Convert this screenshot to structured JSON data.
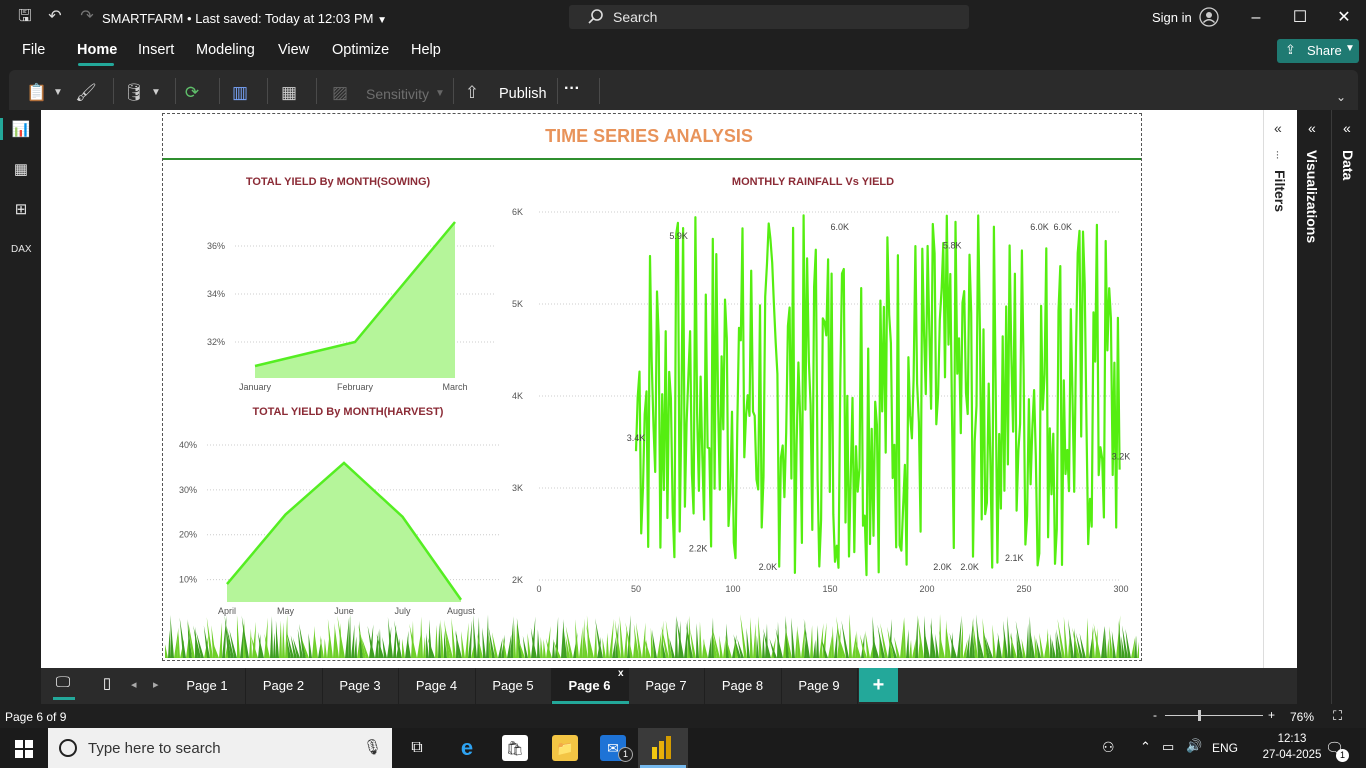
{
  "app": {
    "doc_title": "SMARTFARM",
    "saved_status": "Last saved: Today at 12:03 PM",
    "search_placeholder": "Search",
    "sign_in": "Sign in"
  },
  "menu": {
    "file": "File",
    "home": "Home",
    "insert": "Insert",
    "modeling": "Modeling",
    "view": "View",
    "optimize": "Optimize",
    "help": "Help",
    "share": "Share"
  },
  "ribbon": {
    "sensitivity": "Sensitivity",
    "publish": "Publish",
    "more": "···"
  },
  "report": {
    "title": "TIME SERIES ANALYSIS",
    "sowing_title": "TOTAL YIELD By MONTH(SOWING)",
    "harvest_title": "TOTAL YIELD By MONTH(HARVEST)",
    "rainfall_title": "MONTHLY RAINFALL Vs YIELD"
  },
  "chart_data": [
    {
      "type": "area",
      "title": "TOTAL YIELD By MONTH(SOWING)",
      "categories": [
        "January",
        "February",
        "March"
      ],
      "values": [
        31.0,
        32.0,
        37.0
      ],
      "yticks": [
        "32%",
        "34%",
        "36%"
      ],
      "ylim": [
        30.5,
        37.5
      ],
      "color": "#55ee22"
    },
    {
      "type": "area",
      "title": "TOTAL YIELD By MONTH(HARVEST)",
      "categories": [
        "April",
        "May",
        "June",
        "July",
        "August"
      ],
      "values": [
        9.0,
        24.5,
        36.0,
        24.0,
        5.5
      ],
      "yticks": [
        "10%",
        "20%",
        "30%",
        "40%"
      ],
      "ylim": [
        5,
        42
      ],
      "color": "#55ee22"
    },
    {
      "type": "line",
      "title": "MONTHLY RAINFALL Vs YIELD",
      "xticks": [
        "0",
        "50",
        "100",
        "150",
        "200",
        "250",
        "300"
      ],
      "yticks": [
        "2K",
        "3K",
        "4K",
        "5K",
        "6K"
      ],
      "xlim": [
        0,
        300
      ],
      "ylim": [
        2000,
        6000
      ],
      "color": "#55ee11",
      "x_start": 50,
      "x_end": 300,
      "data_labels": [
        {
          "x": 50,
          "y": 3400,
          "text": "3.4K"
        },
        {
          "x": 72,
          "y": 5900,
          "text": "5.9K"
        },
        {
          "x": 82,
          "y": 2200,
          "text": "2.2K"
        },
        {
          "x": 118,
          "y": 2000,
          "text": "2.0K"
        },
        {
          "x": 155,
          "y": 6000,
          "text": "6.0K"
        },
        {
          "x": 208,
          "y": 2000,
          "text": "2.0K"
        },
        {
          "x": 213,
          "y": 5800,
          "text": "5.8K"
        },
        {
          "x": 222,
          "y": 2000,
          "text": "2.0K"
        },
        {
          "x": 245,
          "y": 2100,
          "text": "2.1K"
        },
        {
          "x": 258,
          "y": 6000,
          "text": "6.0K"
        },
        {
          "x": 270,
          "y": 6000,
          "text": "6.0K"
        },
        {
          "x": 300,
          "y": 3200,
          "text": "3.2K"
        }
      ]
    }
  ],
  "panes": {
    "filters": "Filters",
    "visualizations": "Visualizations",
    "data": "Data"
  },
  "pages": [
    "Page 1",
    "Page 2",
    "Page 3",
    "Page 4",
    "Page 5",
    "Page 6",
    "Page 7",
    "Page 8",
    "Page 9"
  ],
  "active_page": "Page 6",
  "close_tab": "x",
  "add_page": "+",
  "status": {
    "page_info": "Page 6 of 9",
    "zoom": "76%",
    "zoom_minus": "-",
    "zoom_plus": "+"
  },
  "taskbar": {
    "search_placeholder": "Type here to search",
    "lang": "ENG",
    "time": "12:13",
    "date": "27-04-2025",
    "mail_badge": "1",
    "notif_badge": "1"
  }
}
